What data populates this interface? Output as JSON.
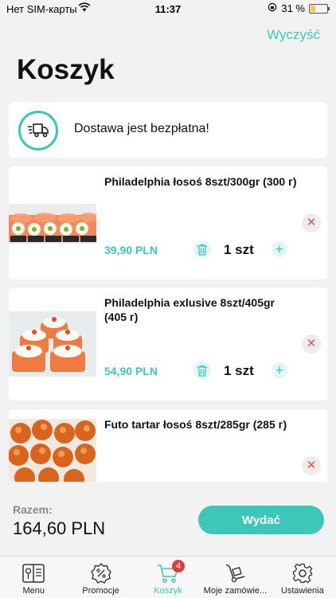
{
  "status_bar": {
    "carrier": "Нет SIM-карты",
    "time": "11:37",
    "battery": "31 %",
    "battery_level": 0.31
  },
  "header": {
    "clear_label": "Wyczyść",
    "title": "Koszyk"
  },
  "delivery": {
    "text": "Dostawa jest bezpłatna!",
    "icon": "delivery-truck-icon"
  },
  "cart": {
    "items": [
      {
        "name": "Philadelphia łosoś  8szt/300gr (300 г)",
        "price": "39,90 PLN",
        "quantity": "1 szt"
      },
      {
        "name": "Philadelphia exlusive 8szt/405gr (405 г)",
        "price": "54,90 PLN",
        "quantity": "1 szt"
      },
      {
        "name": "Futo tartar łosoś 8szt/285gr (285 г)"
      }
    ]
  },
  "footer": {
    "total_label": "Razem:",
    "total_value": "164,60 PLN",
    "checkout_label": "Wydać"
  },
  "tab_bar": {
    "tabs": [
      {
        "label": "Menu",
        "icon": "menu-book-icon"
      },
      {
        "label": "Promocje",
        "icon": "percent-badge-icon"
      },
      {
        "label": "Koszyk",
        "icon": "cart-icon",
        "badge": "4"
      },
      {
        "label": "Moje zamówie...",
        "icon": "hand-truck-icon"
      },
      {
        "label": "Ustawienia",
        "icon": "gear-icon"
      }
    ]
  },
  "colors": {
    "accent": "#3cc7b8",
    "remove": "#d9534f",
    "badge": "#e23b3b"
  }
}
